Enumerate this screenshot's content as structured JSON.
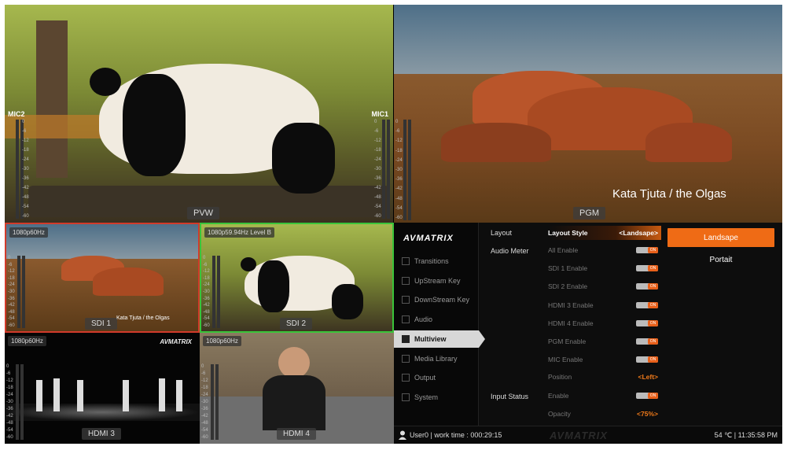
{
  "preview": {
    "label": "PVW",
    "mic_left": "MIC2",
    "mic_right": "MIC1"
  },
  "program": {
    "label": "PGM",
    "caption": "Kata Tjuta / the Olgas"
  },
  "meter_scale": [
    "0",
    "-6",
    "-12",
    "-18",
    "-24",
    "-30",
    "-36",
    "-42",
    "-48",
    "-54",
    "-60"
  ],
  "inputs": [
    {
      "label": "SDI 1",
      "format": "1080p60Hz",
      "caption": "Kata Tjuta / the Olgas",
      "border": "#d23a2a"
    },
    {
      "label": "SDI 2",
      "format": "1080p59.94Hz  Level B",
      "border": "#3ac43a"
    },
    {
      "label": "HDMI 3",
      "format": "1080p60Hz",
      "brand": "AVMATRIX"
    },
    {
      "label": "HDMI 4",
      "format": "1080p60Hz"
    }
  ],
  "panel": {
    "logo": "AVMATRIX",
    "nav": [
      "Transitions",
      "UpStream Key",
      "DownStream Key",
      "Audio",
      "Multiview",
      "Media Library",
      "Output",
      "System"
    ],
    "nav_icons": [
      "transitions-icon",
      "upstream-key-icon",
      "downstream-key-icon",
      "audio-icon",
      "multiview-icon",
      "media-library-icon",
      "output-icon",
      "system-icon"
    ],
    "active_nav": "Multiview",
    "sections": {
      "layout": "Layout",
      "audio_meter": "Audio Meter",
      "input_status": "Input Status"
    },
    "layout_style": {
      "label": "Layout Style",
      "value": "<Landsape>"
    },
    "audio_rows": [
      {
        "label": "All Enable",
        "toggle": "ON"
      },
      {
        "label": "SDI 1 Enable",
        "toggle": "ON"
      },
      {
        "label": "SDI 2 Enable",
        "toggle": "ON"
      },
      {
        "label": "HDMI 3 Enable",
        "toggle": "ON"
      },
      {
        "label": "HDMI 4 Enable",
        "toggle": "ON"
      },
      {
        "label": "PGM Enable",
        "toggle": "ON"
      },
      {
        "label": "MIC Enable",
        "toggle": "ON"
      }
    ],
    "position": {
      "label": "Position",
      "value": "<Left>"
    },
    "status_rows": [
      {
        "label": "Enable",
        "toggle": "ON"
      }
    ],
    "opacity": {
      "label": "Opacity",
      "value": "<75%>"
    },
    "options": [
      "Landsape",
      "Portait"
    ],
    "selected_option": "Landsape"
  },
  "status_bar": {
    "user": "User0 | work time : 000:29:15",
    "watermark": "AVMATRIX",
    "right": "54 ℃ | 11:35:58 PM"
  },
  "colors": {
    "accent": "#ef6b15",
    "tally_red": "#d23a2a",
    "tally_green": "#3ac43a"
  }
}
